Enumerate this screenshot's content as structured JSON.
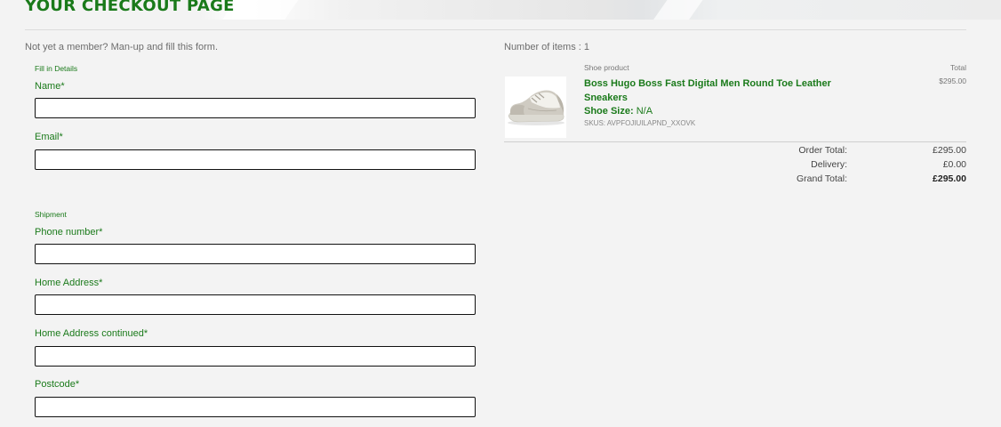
{
  "page": {
    "title": "YOUR CHECKOUT PAGE",
    "member_note": "Not yet a member? Man-up and fill this form."
  },
  "form": {
    "details_heading": "Fill in Details",
    "shipment_heading": "Shipment",
    "fields": {
      "name": {
        "label": "Name*",
        "value": "",
        "placeholder": ""
      },
      "email": {
        "label": "Email*",
        "value": "",
        "placeholder": ""
      },
      "phone": {
        "label": "Phone number*",
        "value": "",
        "placeholder": ""
      },
      "address1": {
        "label": "Home Address*",
        "value": "",
        "placeholder": ""
      },
      "address2": {
        "label": "Home Address continued*",
        "value": "",
        "placeholder": ""
      },
      "postcode": {
        "label": "Postcode*",
        "value": "",
        "placeholder": ""
      }
    }
  },
  "cart": {
    "items_count": "Number of items : 1",
    "column_product": "Shoe product",
    "column_total": "Total",
    "item": {
      "name": "Boss Hugo Boss Fast Digital Men Round Toe Leather Sneakers",
      "size_label": "Shoe Size:",
      "size_value": "N/A",
      "skus": "SKUS: AVPFOJIUILAPND_XXOVK",
      "total": "$295.00",
      "image_icon": "sneaker-image"
    },
    "summary": {
      "order_total_label": "Order Total:",
      "order_total": "£295.00",
      "delivery_label": "Delivery:",
      "delivery": "£0.00",
      "grand_total_label": "Grand Total:",
      "grand_total": "£295.00"
    }
  },
  "colors": {
    "accent": "#1a7a1a",
    "background": "#f3f3f3"
  }
}
